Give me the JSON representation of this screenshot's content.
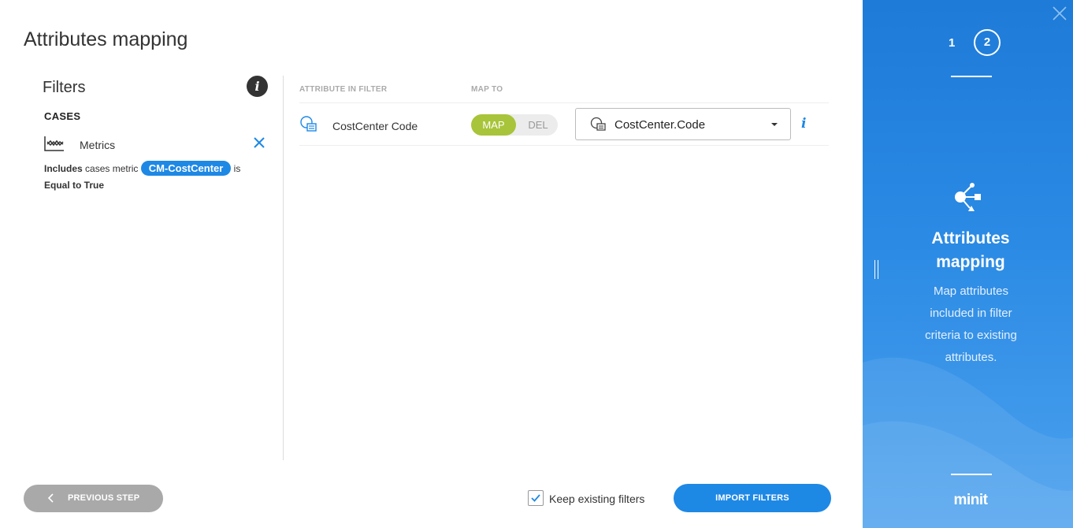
{
  "page": {
    "title": "Attributes mapping"
  },
  "filters": {
    "title": "Filters",
    "info_glyph": "i",
    "section_label": "CASES",
    "item": {
      "icon": "metrics-chart-icon",
      "label": "Metrics",
      "description": {
        "prefix_bold": "Includes",
        "middle": " cases metric ",
        "chip": "CM-CostCenter",
        "suffix": " is",
        "condition": "Equal to True"
      }
    }
  },
  "mapping": {
    "columns": [
      "ATTRIBUTE IN FILTER",
      "MAP TO"
    ],
    "rows": [
      {
        "attribute": "CostCenter Code",
        "attribute_icon": "attribute-icon",
        "toggle": {
          "map": "MAP",
          "del": "DEL",
          "active": "MAP"
        },
        "mapped_to": "CostCenter.Code",
        "info_glyph": "i"
      }
    ]
  },
  "footer": {
    "previous": "PREVIOUS STEP",
    "keep_existing": {
      "label": "Keep existing filters",
      "checked": true
    },
    "import": "IMPORT FILTERS"
  },
  "side_panel": {
    "steps": [
      "1",
      "2"
    ],
    "active_step": "2",
    "icon": "share-mapping-icon",
    "title_line1": "Attributes",
    "title_line2": "mapping",
    "description": "Map attributes included in filter criteria to existing attributes.",
    "logo": "minit"
  },
  "colors": {
    "accent": "#1e88e5",
    "toggle_active": "#a8c43a",
    "button_disabled": "#a9a9a9",
    "panel": "#1e7bd8"
  }
}
